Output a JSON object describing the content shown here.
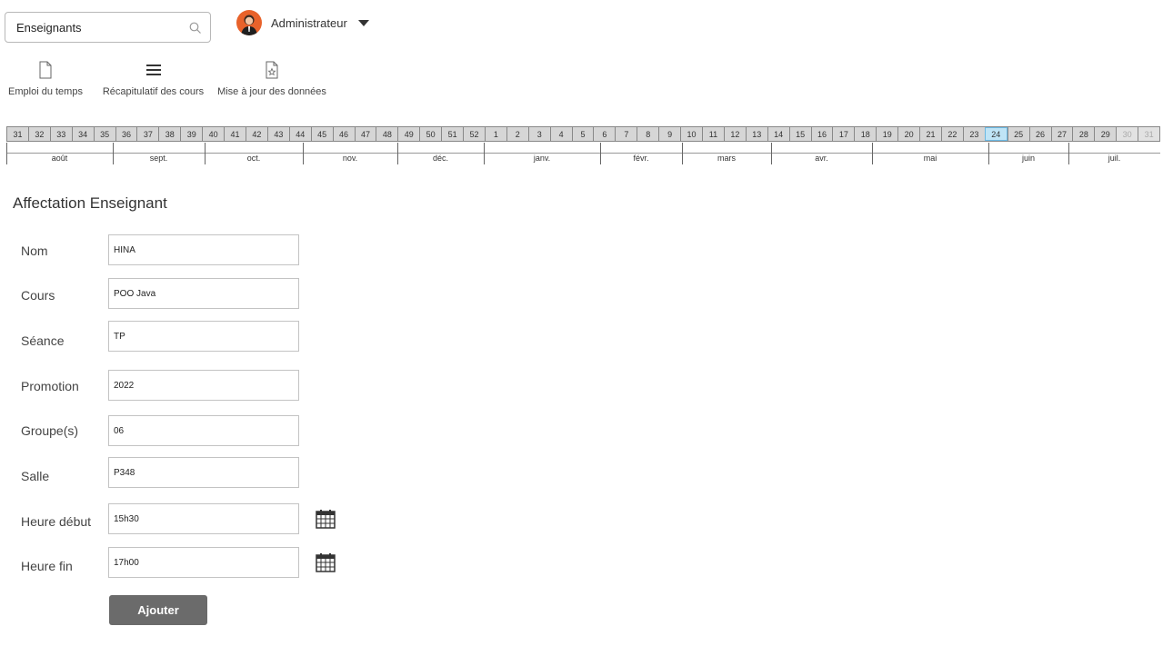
{
  "search": {
    "value": "Enseignants",
    "icon": "search-icon"
  },
  "user": {
    "name": "Administrateur",
    "avatar_color": "#e8622a"
  },
  "toolbar": {
    "items": [
      {
        "label": "Emploi du temps",
        "icon": "document-icon"
      },
      {
        "label": "Récapitulatif des cours",
        "icon": "menu-icon"
      },
      {
        "label": "Mise à jour des données",
        "icon": "star-document-icon"
      }
    ]
  },
  "calendar": {
    "weeks": [
      "31",
      "32",
      "33",
      "34",
      "35",
      "36",
      "37",
      "38",
      "39",
      "40",
      "41",
      "42",
      "43",
      "44",
      "45",
      "46",
      "47",
      "48",
      "49",
      "50",
      "51",
      "52",
      "1",
      "2",
      "3",
      "4",
      "5",
      "6",
      "7",
      "8",
      "9",
      "10",
      "11",
      "12",
      "13",
      "14",
      "15",
      "16",
      "17",
      "18",
      "19",
      "20",
      "21",
      "22",
      "23",
      "24",
      "25",
      "26",
      "27",
      "28",
      "29",
      "30",
      "31"
    ],
    "current_week": "24",
    "current_week_color": "#bfe4f6",
    "months": [
      {
        "label": "août"
      },
      {
        "label": "sept."
      },
      {
        "label": "oct."
      },
      {
        "label": "nov."
      },
      {
        "label": "déc."
      },
      {
        "label": "janv."
      },
      {
        "label": "févr."
      },
      {
        "label": "mars"
      },
      {
        "label": "avr."
      },
      {
        "label": "mai"
      },
      {
        "label": "juin"
      },
      {
        "label": "juil."
      }
    ]
  },
  "form": {
    "title": "Affectation Enseignant",
    "fields": [
      {
        "label": "Nom",
        "value": "HINA"
      },
      {
        "label": "Cours",
        "value": "POO Java"
      },
      {
        "label": "Séance",
        "value": "TP"
      },
      {
        "label": "Promotion",
        "value": "2022"
      },
      {
        "label": "Groupe(s)",
        "value": "06"
      },
      {
        "label": "Salle",
        "value": "P348"
      },
      {
        "label": "Heure début",
        "value": "15h30"
      },
      {
        "label": "Heure fin",
        "value": "17h00"
      }
    ],
    "submit_label": "Ajouter",
    "button_color": "#6b6b6b"
  }
}
